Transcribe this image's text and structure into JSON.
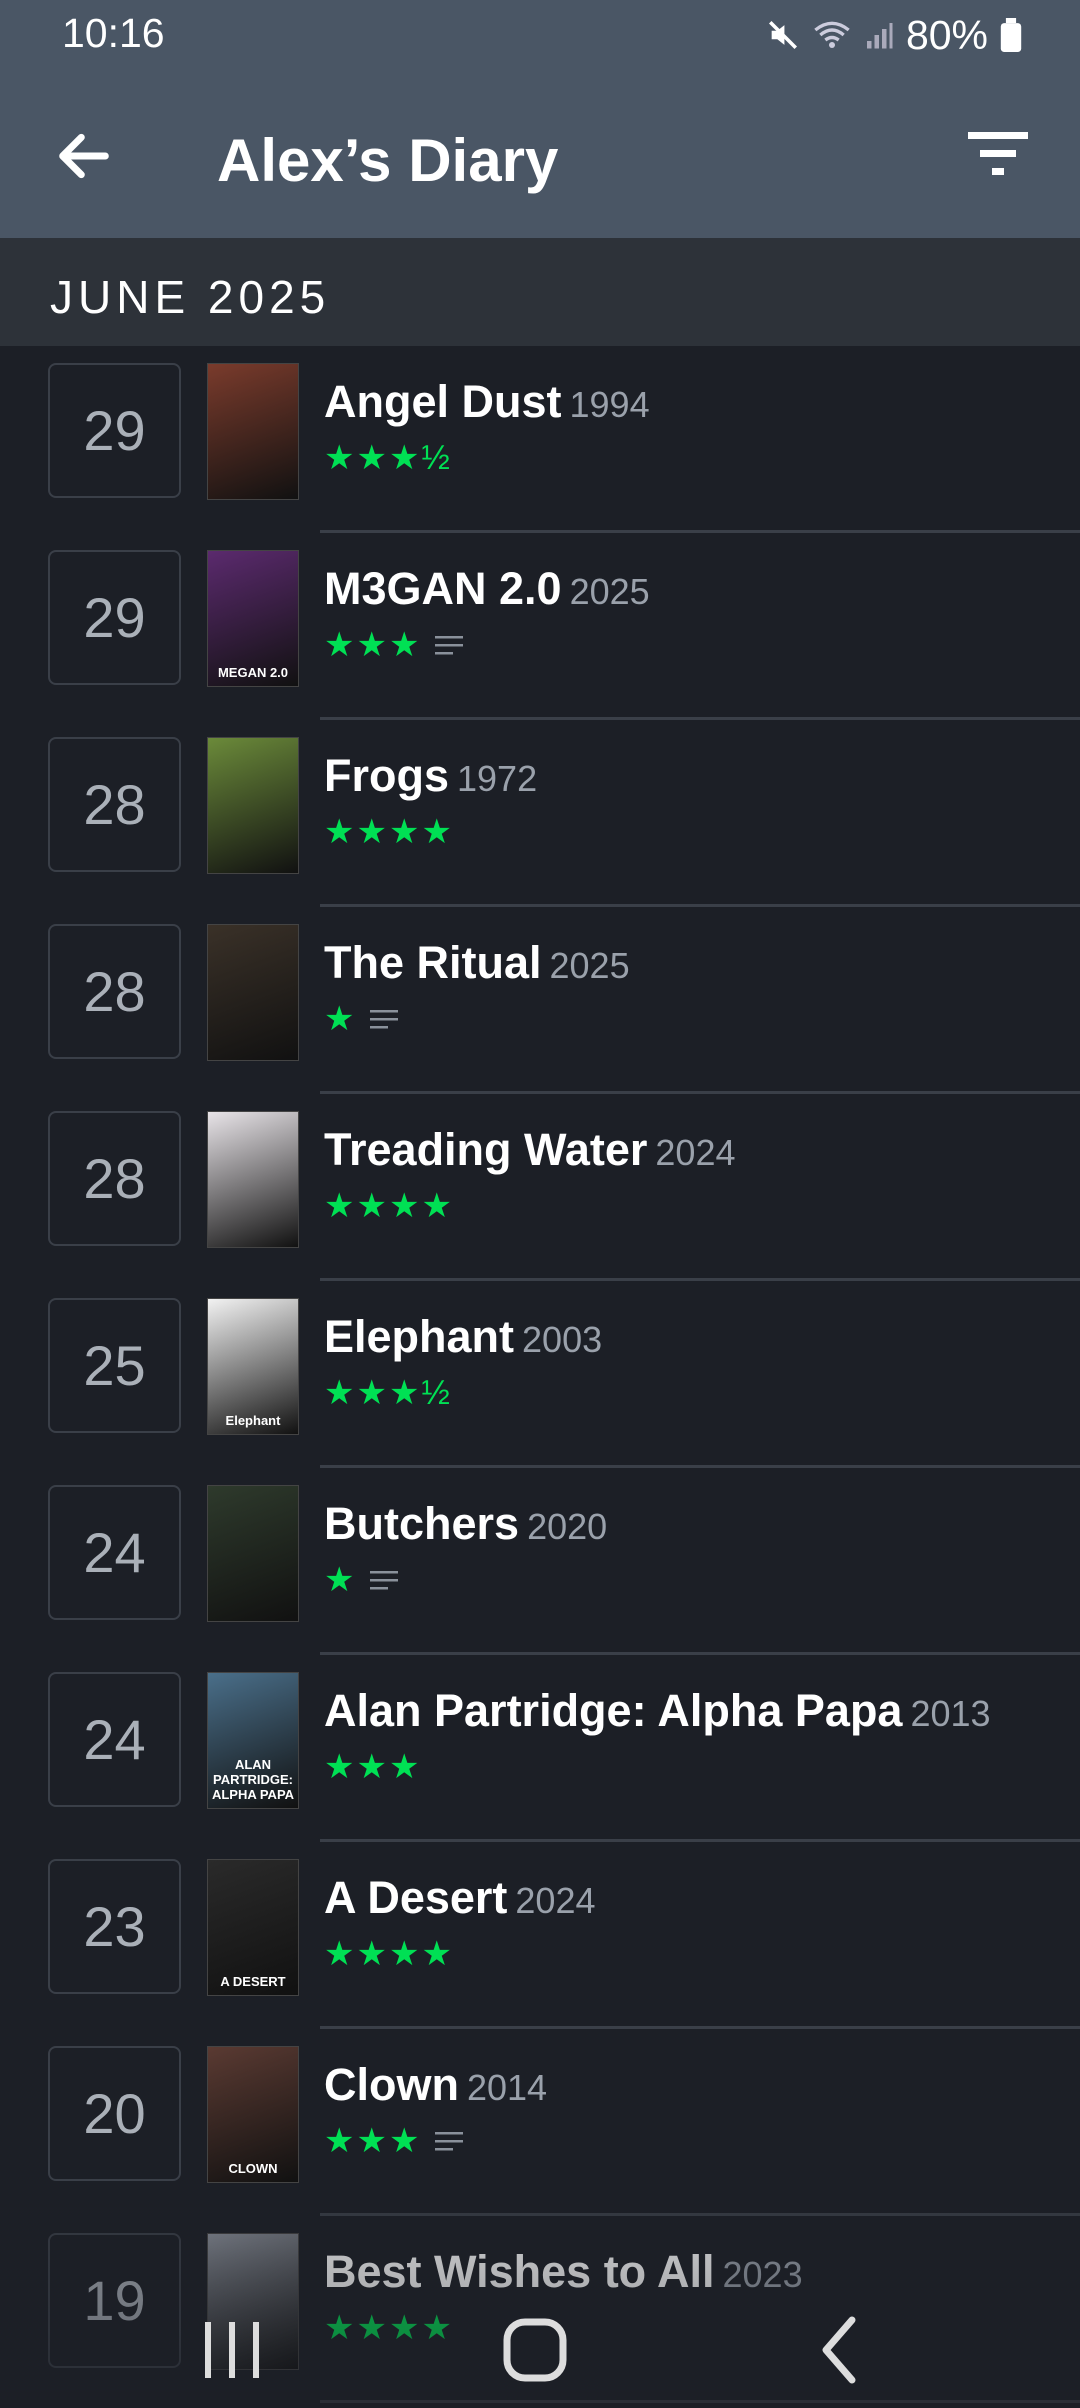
{
  "status": {
    "time": "10:16",
    "battery": "80%"
  },
  "header": {
    "title": "Alex’s Diary"
  },
  "section": {
    "label": "JUNE 2025"
  },
  "entries": [
    {
      "day": "29",
      "title": "Angel Dust",
      "year": "1994",
      "stars": "★★★½",
      "has_review": false,
      "poster_color": "#7a3b2c"
    },
    {
      "day": "29",
      "title": "M3GAN 2.0",
      "year": "2025",
      "stars": "★★★",
      "has_review": true,
      "poster_color": "#5b2a6e"
    },
    {
      "day": "28",
      "title": "Frogs",
      "year": "1972",
      "stars": "★★★★",
      "has_review": false,
      "poster_color": "#6b8a3a"
    },
    {
      "day": "28",
      "title": "The Ritual",
      "year": "2025",
      "stars": "★",
      "has_review": true,
      "poster_color": "#3a3128"
    },
    {
      "day": "28",
      "title": "Treading Water",
      "year": "2024",
      "stars": "★★★★",
      "has_review": false,
      "poster_color": "#e8e4e8"
    },
    {
      "day": "25",
      "title": "Elephant",
      "year": "2003",
      "stars": "★★★½",
      "has_review": false,
      "poster_color": "#f2f2f2"
    },
    {
      "day": "24",
      "title": "Butchers",
      "year": "2020",
      "stars": "★",
      "has_review": true,
      "poster_color": "#2e3a2c"
    },
    {
      "day": "24",
      "title": "Alan Partridge: Alpha Papa",
      "year": "2013",
      "stars": "★★★",
      "has_review": false,
      "poster_color": "#4a6f8a"
    },
    {
      "day": "23",
      "title": "A Desert",
      "year": "2024",
      "stars": "★★★★",
      "has_review": false,
      "poster_color": "#2a2a2a"
    },
    {
      "day": "20",
      "title": "Clown",
      "year": "2014",
      "stars": "★★★",
      "has_review": true,
      "poster_color": "#5a3a32"
    },
    {
      "day": "19",
      "title": "Best Wishes to All",
      "year": "2023",
      "stars": "★★★★",
      "has_review": false,
      "poster_color": "#8a8f99"
    }
  ],
  "poster_texts": {
    "1": "MEGAN 2.0",
    "5": "Elephant",
    "7": "ALAN PARTRIDGE: ALPHA PAPA",
    "8": "A DESERT",
    "9": "CLOWN"
  }
}
